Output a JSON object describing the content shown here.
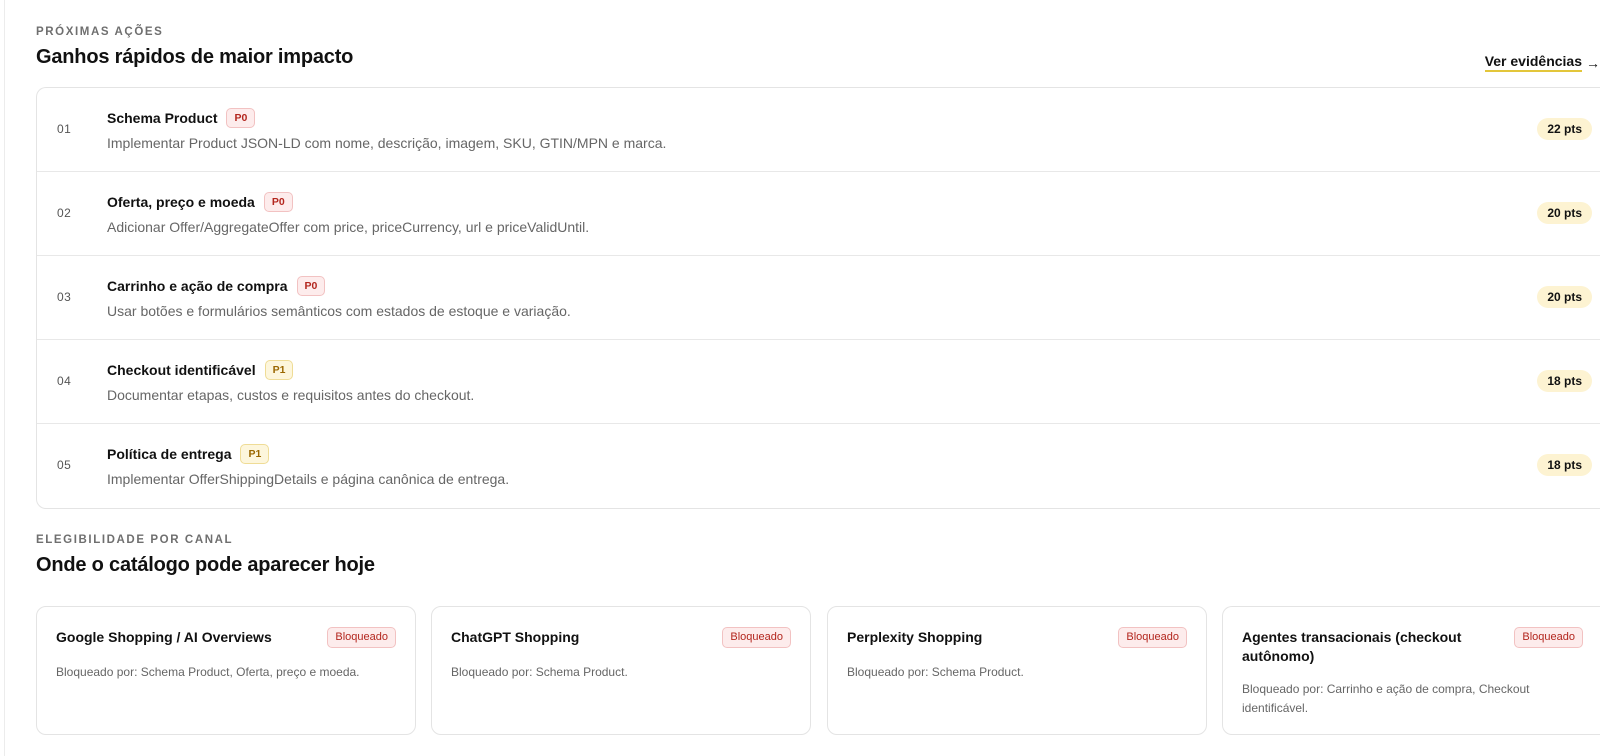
{
  "next_actions": {
    "eyebrow": "PRÓXIMAS AÇÕES",
    "title": "Ganhos rápidos de maior impacto",
    "link_label": "Ver evidências",
    "items": [
      {
        "num": "01",
        "title": "Schema Product",
        "priority": "P0",
        "desc": "Implementar Product JSON-LD com nome, descrição, imagem, SKU, GTIN/MPN e marca.",
        "points": "22 pts"
      },
      {
        "num": "02",
        "title": "Oferta, preço e moeda",
        "priority": "P0",
        "desc": "Adicionar Offer/AggregateOffer com price, priceCurrency, url e priceValidUntil.",
        "points": "20 pts"
      },
      {
        "num": "03",
        "title": "Carrinho e ação de compra",
        "priority": "P0",
        "desc": "Usar botões e formulários semânticos com estados de estoque e variação.",
        "points": "20 pts"
      },
      {
        "num": "04",
        "title": "Checkout identificável",
        "priority": "P1",
        "desc": "Documentar etapas, custos e requisitos antes do checkout.",
        "points": "18 pts"
      },
      {
        "num": "05",
        "title": "Política de entrega",
        "priority": "P1",
        "desc": "Implementar OfferShippingDetails e página canônica de entrega.",
        "points": "18 pts"
      }
    ]
  },
  "eligibility": {
    "eyebrow": "ELEGIBILIDADE POR CANAL",
    "title": "Onde o catálogo pode aparecer hoje",
    "cards": [
      {
        "title": "Google Shopping / AI Overviews",
        "status": "Bloqueado",
        "desc": "Bloqueado por: Schema Product, Oferta, preço e moeda."
      },
      {
        "title": "ChatGPT Shopping",
        "status": "Bloqueado",
        "desc": "Bloqueado por: Schema Product."
      },
      {
        "title": "Perplexity Shopping",
        "status": "Bloqueado",
        "desc": "Bloqueado por: Schema Product."
      },
      {
        "title": "Agentes transacionais (checkout autônomo)",
        "status": "Bloqueado",
        "desc": "Bloqueado por: Carrinho e ação de compra, Checkout identificável."
      }
    ]
  },
  "colors": {
    "p0": "#b3261e",
    "p1": "#9a6700",
    "points_bg": "#fdf3d2",
    "link_underline": "#e3c63a"
  }
}
